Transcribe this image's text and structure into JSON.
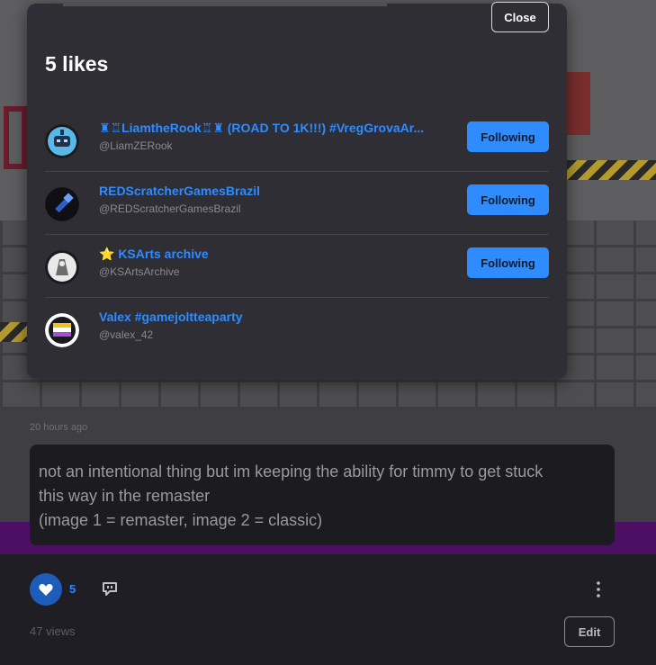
{
  "modal": {
    "title": "5 likes",
    "close_label": "Close",
    "users": [
      {
        "name": "♜♖LiamtheRook♖♜ (ROAD TO 1K!!!) #VregGrovaAr...",
        "handle": "@LiamZERook",
        "button": "Following",
        "avatar_icon": "robot-avatar"
      },
      {
        "name": "REDScratcherGamesBrazil",
        "handle": "@REDScratcherGamesBrazil",
        "button": "Following",
        "avatar_icon": "pixel-tool-avatar"
      },
      {
        "name": "⭐ KSArts archive",
        "handle": "@KSArtsArchive",
        "button": "Following",
        "avatar_icon": "sketch-avatar"
      },
      {
        "name": "Valex #gamejoltteaparty",
        "handle": "@valex_42",
        "button": null,
        "avatar_icon": "flag-avatar"
      }
    ]
  },
  "post": {
    "timestamp": "20 hours ago",
    "caption_lines": [
      "not an intentional thing but im keeping the ability for timmy to get stuck",
      "this way in the remaster",
      "(image 1 = remaster, image 2 = classic)"
    ],
    "like_count": "5",
    "views": "47 views",
    "edit_label": "Edit"
  },
  "colors": {
    "accent": "#2e8cff",
    "modal_bg": "#2f2e35",
    "page_bg": "#1f1e24",
    "purple": "#4b0f63"
  }
}
